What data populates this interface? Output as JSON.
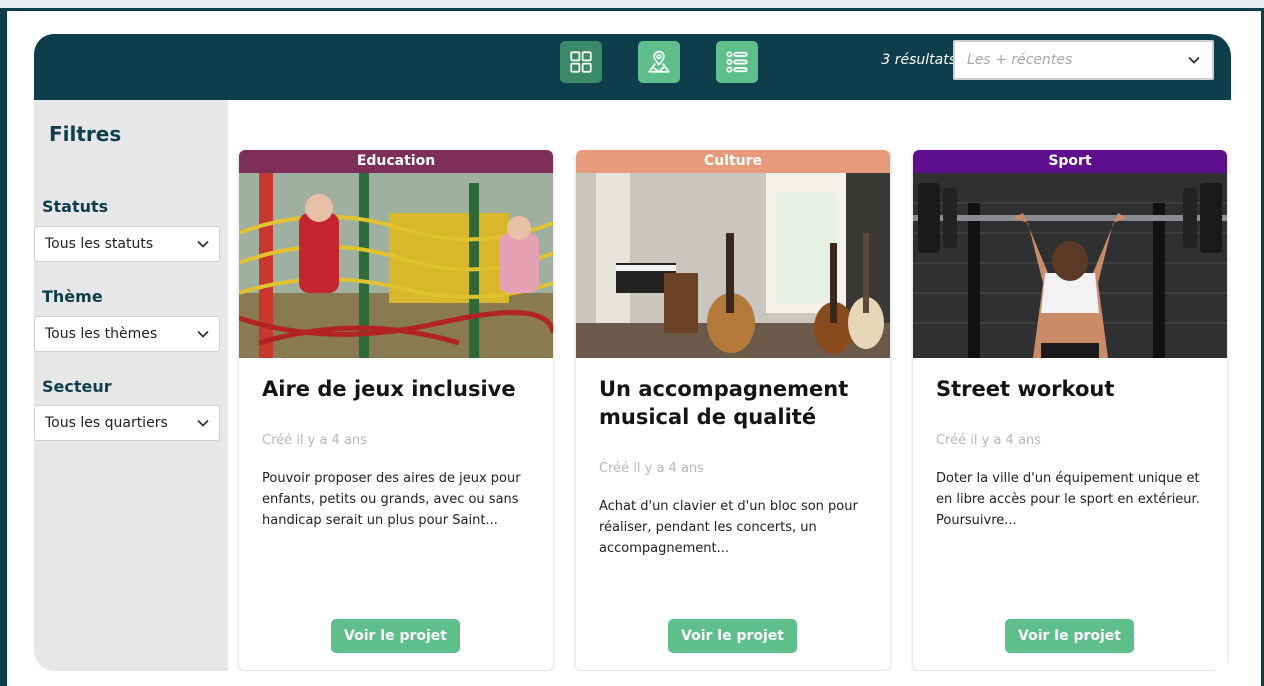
{
  "header": {
    "results_text": "3 résultats",
    "sort_placeholder": "Les + récentes",
    "view_buttons": [
      {
        "name": "grid-view-icon",
        "active": false
      },
      {
        "name": "map-view-icon",
        "active": true
      },
      {
        "name": "list-view-icon",
        "active": true
      }
    ]
  },
  "sidebar": {
    "title": "Filtres",
    "filters": [
      {
        "label": "Statuts",
        "value": "Tous les statuts"
      },
      {
        "label": "Thème",
        "value": "Tous les thèmes"
      },
      {
        "label": "Secteur",
        "value": "Tous les quartiers"
      }
    ]
  },
  "cards": [
    {
      "tag": "Education",
      "tag_color": "#7d2f5a",
      "title": "Aire de jeux inclusive",
      "date": "Créé il y a 4 ans",
      "description": "Pouvoir proposer des aires de jeux pour enfants, petits ou grands, avec ou sans handicap serait un plus pour Saint...",
      "button": "Voir le projet",
      "image": "playground-photo"
    },
    {
      "tag": "Culture",
      "tag_color": "#e89a7c",
      "title": "Un accompagnement musical de qualité",
      "date": "Créé il y a 4 ans",
      "description": "Achat d'un clavier et d'un bloc son pour réaliser, pendant les concerts, un accompagnement...",
      "button": "Voir le projet",
      "image": "music-room-photo"
    },
    {
      "tag": "Sport",
      "tag_color": "#5d0f8f",
      "title": "Street workout",
      "date": "Créé il y a 4 ans",
      "description": "Doter la ville d'un équipement unique et en libre accès pour le sport en extérieur. Poursuivre...",
      "button": "Voir le projet",
      "image": "weightlifting-photo"
    }
  ],
  "colors": {
    "brand": "#0e3e4c",
    "accent": "#5fbf8b",
    "sidebar_bg": "#e7e7e7"
  }
}
